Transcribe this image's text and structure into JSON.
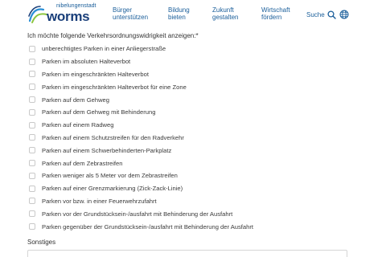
{
  "header": {
    "logo_top": "nibelungenstadt",
    "logo_word": "worms",
    "nav": [
      {
        "line1": "Bürger",
        "line2": "unterstützen"
      },
      {
        "line1": "Bildung",
        "line2": "bieten"
      },
      {
        "line1": "Zukunft",
        "line2": "gestalten"
      },
      {
        "line1": "Wirtschaft",
        "line2": "fördern"
      }
    ],
    "search_label": "Suche",
    "icons": [
      "search-icon",
      "globe-icon"
    ],
    "accent_color": "#1a5e9a"
  },
  "form": {
    "question": "Ich möchte folgende Verkehrsordnungswidrigkeit anzeigen:*",
    "options": [
      "unberechtigtes Parken in einer Anliegerstraße",
      "Parken im absoluten Halteverbot",
      "Parken im eingeschränkten Halteverbot",
      "Parken im eingeschränkten Halteverbot für eine Zone",
      "Parken auf dem Gehweg",
      "Parken auf dem Gehweg mit Behinderung",
      "Parken auf einem Radweg",
      "Parken auf einem Schutzstreifen für den Radverkehr",
      "Parken auf einem Schwerbehinderten-Parkplatz",
      "Parken auf dem Zebrastreifen",
      "Parken weniger als 5 Meter vor dem Zebrastreifen",
      "Parken auf einer Grenzmarkierung (Zick-Zack-Linie)",
      "Parken vor bzw. in einer Feuerwehrzufahrt",
      "Parken vor der Grundstücksein-/ausfahrt mit Behinderung der Ausfahrt",
      "Parken gegenüber der Grundstücksein-/ausfahrt mit Behinderung der Ausfahrt"
    ],
    "other_label": "Sonstiges",
    "other_value": ""
  }
}
